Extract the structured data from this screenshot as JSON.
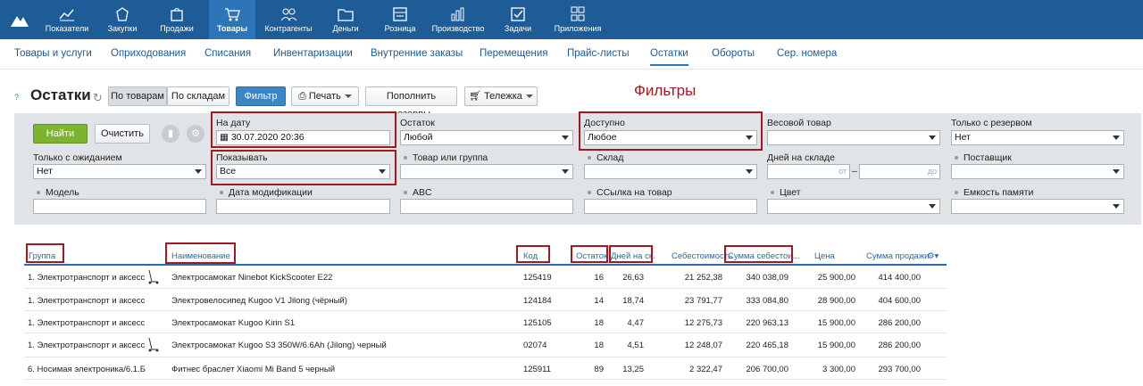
{
  "topnav": {
    "items": [
      {
        "label": "Показатели",
        "icon": "chart-icon"
      },
      {
        "label": "Закупки",
        "icon": "bag-icon"
      },
      {
        "label": "Продажи",
        "icon": "shopping-bag-icon"
      },
      {
        "label": "Товары",
        "icon": "cart-icon",
        "active": true
      },
      {
        "label": "Контрагенты",
        "icon": "users-icon"
      },
      {
        "label": "Деньги",
        "icon": "folder-icon"
      },
      {
        "label": "Розница",
        "icon": "cash-register-icon"
      },
      {
        "label": "Производство",
        "icon": "factory-icon"
      },
      {
        "label": "Задачи",
        "icon": "checkbox-icon"
      },
      {
        "label": "Приложения",
        "icon": "apps-icon"
      }
    ]
  },
  "subnav": {
    "items": [
      "Товары и услуги",
      "Оприходования",
      "Списания",
      "Инвентаризации",
      "Внутренние заказы",
      "Перемещения",
      "Прайс-листы",
      "Остатки",
      "Обороты",
      "Сер. номера"
    ],
    "active": "Остатки"
  },
  "toolbar": {
    "title": "Остатки",
    "by_goods": "По товарам",
    "by_warehouses": "По складам",
    "filter": "Фильтр",
    "print": "Печать",
    "fill_reserves": "Пополнить резервы",
    "cart": "Тележка"
  },
  "annotation": "Фильтры",
  "filters": {
    "find": "Найти",
    "clear": "Очистить",
    "on_date_label": "На дату",
    "on_date_value": "30.07.2020 20:36",
    "balance_label": "Остаток",
    "balance_value": "Любой",
    "available_label": "Доступно",
    "available_value": "Любое",
    "weight_label": "Весовой товар",
    "weight_value": "",
    "reserve_label": "Только с резервом",
    "reserve_value": "Нет",
    "waiting_label": "Только с ожиданием",
    "waiting_value": "Нет",
    "show_label": "Показывать",
    "show_value": "Все",
    "product_group_label": "Товар или группа",
    "warehouse_label": "Склад",
    "days_label": "Дней на складе",
    "days_from_ph": "от",
    "days_dash": "–",
    "days_to_ph": "до",
    "supplier_label": "Поставщик",
    "model_label": "Модель",
    "modified_label": "Дата модификации",
    "abc_label": "ABC",
    "link_label": "ССылка на товар",
    "color_label": "Цвет",
    "memory_label": "Емкость памяти"
  },
  "table": {
    "headers": {
      "group": "Группа",
      "name": "Наименование",
      "code": "Код",
      "stock": "Остаток",
      "days": "Дней на ск.",
      "cost": "Себестоимость",
      "cost_sum": "Сумма себестои...",
      "price": "Цена",
      "sales_sum": "Сумма продажи"
    },
    "rows": [
      {
        "group": "1. Электротранспорт и аксесс",
        "name": "Электросамокат Ninebot KickScooter E22",
        "code": "125419",
        "stock": "16",
        "days": "26,63",
        "cost": "21 252,38",
        "cost_sum": "340 038,09",
        "price": "25 900,00",
        "sales_sum": "414 400,00",
        "icon": "scooter-icon"
      },
      {
        "group": "1. Электротранспорт и аксесс",
        "name": "Электровелосипед Kugoo V1 Jilong (чёрный)",
        "code": "124184",
        "stock": "14",
        "days": "18,74",
        "cost": "23 791,77",
        "cost_sum": "333 084,80",
        "price": "28 900,00",
        "sales_sum": "404 600,00"
      },
      {
        "group": "1. Электротранспорт и аксесс",
        "name": "Электросамокат Kugoo Kirin S1",
        "code": "125105",
        "stock": "18",
        "days": "4,47",
        "cost": "12 275,73",
        "cost_sum": "220 963,13",
        "price": "15 900,00",
        "sales_sum": "286 200,00"
      },
      {
        "group": "1. Электротранспорт и аксесс",
        "name": "Электросамокат Kugoo S3 350W/6.6Ah (Jilong) черный",
        "code": "02074",
        "stock": "18",
        "days": "4,51",
        "cost": "12 248,07",
        "cost_sum": "220 465,18",
        "price": "15 900,00",
        "sales_sum": "286 200,00",
        "icon": "scooter-icon"
      },
      {
        "group": "6. Носимая электроника/6.1.Б",
        "name": "Фитнес браслет Xiaomi Mi Band 5 черный",
        "code": "125911",
        "stock": "89",
        "days": "13,25",
        "cost": "2 322,47",
        "cost_sum": "206 700,00",
        "price": "3 300,00",
        "sales_sum": "293 700,00"
      }
    ]
  },
  "colors": {
    "topbar": "#1d5c96",
    "active_tab": "#2c75b8",
    "annotation_red": "#a11a1f",
    "find_green": "#7cb52d"
  }
}
